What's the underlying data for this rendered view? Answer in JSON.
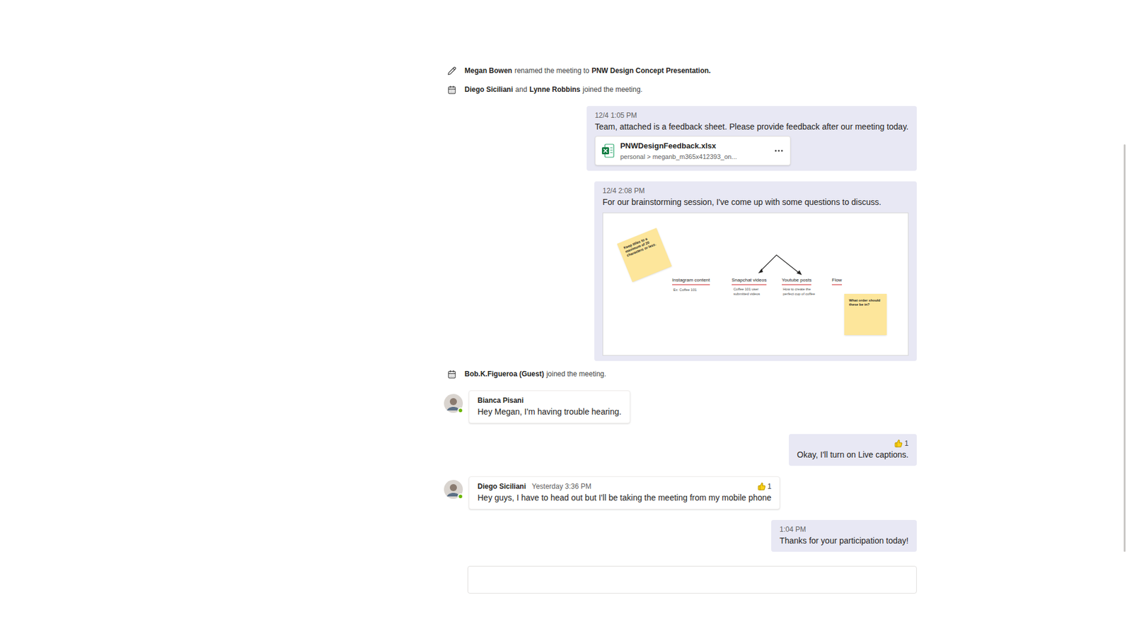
{
  "chat": {
    "timeline": [
      {
        "kind": "system",
        "icon": "rename",
        "parts": [
          {
            "text": "Megan Bowen",
            "bold": true
          },
          {
            "text": "renamed the meeting to",
            "bold": false
          },
          {
            "text": "PNW Design Concept Presentation.",
            "bold": true
          }
        ]
      },
      {
        "kind": "system",
        "icon": "join",
        "parts": [
          {
            "text": "Diego Siciliani",
            "bold": true
          },
          {
            "text": "and",
            "bold": false
          },
          {
            "text": "Lynne Robbins",
            "bold": true
          },
          {
            "text": "joined the meeting.",
            "bold": false
          }
        ]
      },
      {
        "kind": "own",
        "time": "12/4 1:05 PM",
        "text": "Team, attached is a feedback sheet. Please provide feedback after our meeting today.",
        "attachment": {
          "name": "PNWDesignFeedback.xlsx",
          "path": "personal > meganb_m365x412393_on..."
        }
      },
      {
        "kind": "own",
        "time": "12/4 2:08 PM",
        "text": "For our brainstorming session, I've come up with some questions to discuss.",
        "whiteboard": {
          "items": [
            {
              "kind": "sticky",
              "text": "Keep titles to a maximum of 20 characters or less."
            },
            {
              "kind": "heading",
              "text": "Instagram content"
            },
            {
              "kind": "caption",
              "text": "Ex: Coffee 101"
            },
            {
              "kind": "heading",
              "text": "Snapchat videos"
            },
            {
              "kind": "caption",
              "text": "Coffee 101 user submitted videos"
            },
            {
              "kind": "heading",
              "text": "Youtube posts"
            },
            {
              "kind": "caption",
              "text": "How to create the perfect cup of coffee"
            },
            {
              "kind": "heading",
              "text": "Flow"
            },
            {
              "kind": "sticky",
              "text": "What order should these be in?"
            }
          ]
        }
      },
      {
        "kind": "system",
        "icon": "join",
        "parts": [
          {
            "text": "Bob.K.Figueroa (Guest)",
            "bold": true
          },
          {
            "text": "joined the meeting.",
            "bold": false
          }
        ]
      },
      {
        "kind": "other",
        "author": "Bianca Pisani",
        "time": "",
        "text": "Hey Megan, I'm having trouble hearing.",
        "online": true
      },
      {
        "kind": "own",
        "time": "",
        "text": "Okay, I'll turn on Live captions.",
        "reaction": {
          "count": "1"
        }
      },
      {
        "kind": "other",
        "author": "Diego Siciliani",
        "time": "Yesterday 3:36 PM",
        "text": "Hey guys, I have to head out but I'll be taking the meeting from my mobile phone",
        "online": true,
        "reaction": {
          "count": "1"
        }
      },
      {
        "kind": "own",
        "time": "1:04 PM",
        "text": "Thanks for your participation today!"
      }
    ]
  }
}
